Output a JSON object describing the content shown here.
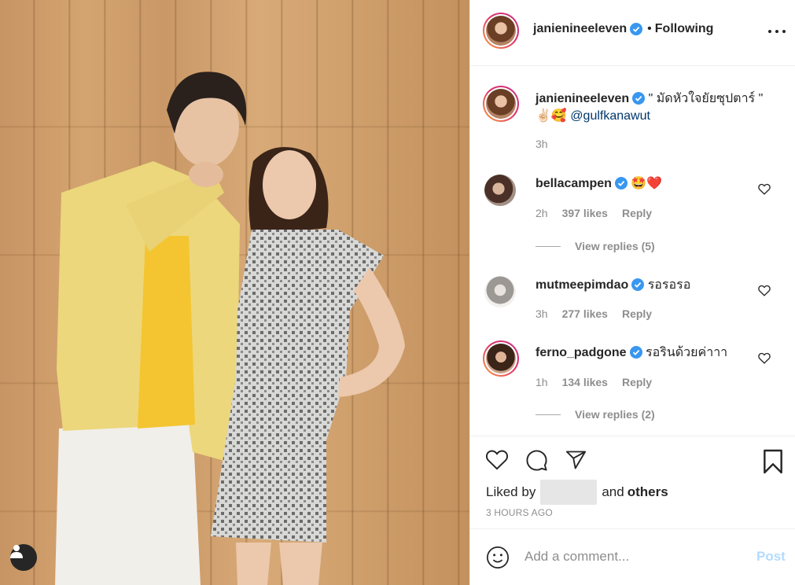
{
  "post": {
    "author": "janienineeleven",
    "follow_separator": "•",
    "follow_state": "Following",
    "caption_username": "janienineeleven",
    "caption_text": "\" มัดหัวใจยัยซุปตาร์ \" ✌🏻🥰",
    "caption_mention": "@gulfkanawut",
    "caption_time": "3h"
  },
  "comments": [
    {
      "username": "bellacampen",
      "text": "🤩❤️",
      "time": "2h",
      "likes": "397 likes",
      "reply": "Reply",
      "view_replies": "View replies (5)"
    },
    {
      "username": "mutmeepimdao",
      "text": "รอรอรอ",
      "time": "3h",
      "likes": "277 likes",
      "reply": "Reply"
    },
    {
      "username": "ferno_padgone",
      "text": "รอรินด้วยค่าาา",
      "time": "1h",
      "likes": "134 likes",
      "reply": "Reply",
      "view_replies": "View replies (2)"
    }
  ],
  "actions": {
    "liked_by_prefix": "Liked by",
    "liked_by_and": "and",
    "liked_by_others": "others",
    "post_time": "3 HOURS AGO"
  },
  "add_comment": {
    "placeholder": "Add a comment...",
    "post_label": "Post"
  },
  "colors": {
    "verified": "#3897f0",
    "heart_red": "#ed4956",
    "post_disabled": "#b3dbff",
    "meta_grey": "#8e8e8e"
  },
  "icons": [
    "user-icon",
    "verified-badge-icon",
    "more-options-icon",
    "heart-outline-icon",
    "comment-icon",
    "share-icon",
    "bookmark-icon",
    "emoji-icon"
  ]
}
